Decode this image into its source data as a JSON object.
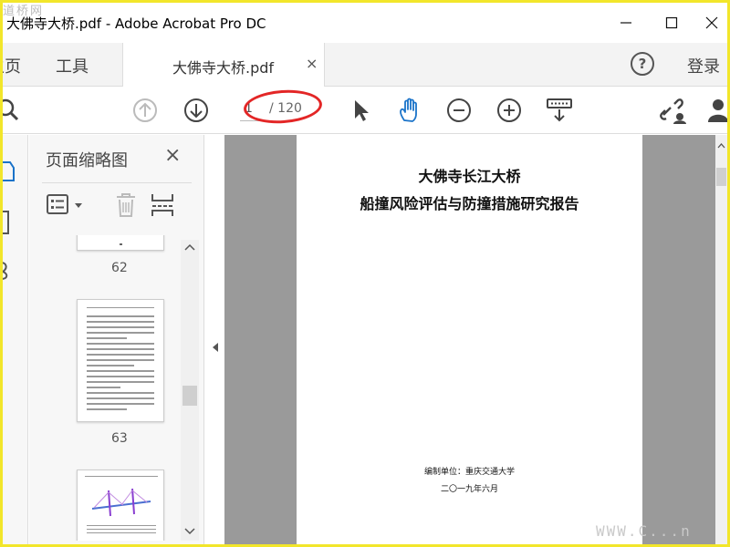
{
  "window": {
    "title": "大佛寺大桥.pdf - Adobe Acrobat Pro DC",
    "watermark_top": "道桥网"
  },
  "tabs": {
    "home": "主页",
    "tools": "工具",
    "document": "大佛寺大桥.pdf",
    "close": "×",
    "help": "?",
    "login": "登录"
  },
  "toolbar": {
    "current_page": "1",
    "total_pages": "/ 120",
    "icons": [
      "search-icon",
      "page-up-icon",
      "page-down-icon",
      "select-icon",
      "hand-icon",
      "zoom-out-icon",
      "zoom-in-icon",
      "keyboard-icon",
      "share-link-icon",
      "user-icon"
    ],
    "highlight_color": "#e32626"
  },
  "panel": {
    "title": "页面缩略图",
    "close": "×",
    "thumb_numbers": [
      "62",
      "63"
    ]
  },
  "document": {
    "line1": "大佛寺长江大桥",
    "line2": "船撞风险评估与防撞措施研究报告",
    "unit": "编制单位：重庆交通大学",
    "date": "二〇一九年六月"
  },
  "watermark_bottom": "WWW.C...n"
}
